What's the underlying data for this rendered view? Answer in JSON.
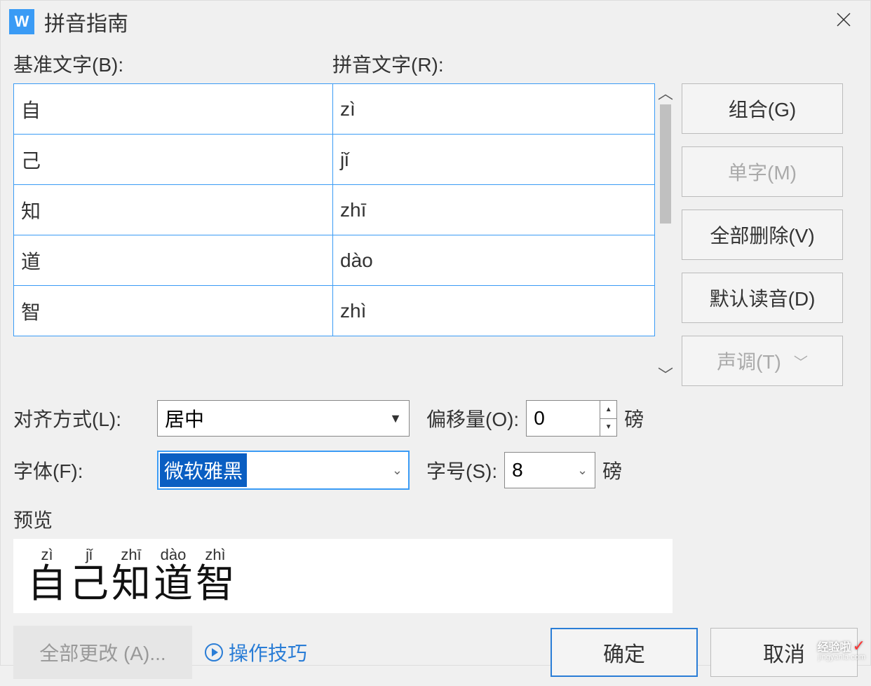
{
  "window": {
    "title": "拼音指南",
    "app_icon_letter": "W"
  },
  "labels": {
    "base_text": "基准文字(B):",
    "pinyin_text": "拼音文字(R):",
    "align": "对齐方式(L):",
    "offset": "偏移量(O):",
    "font": "字体(F):",
    "size": "字号(S):",
    "unit_pt": "磅",
    "preview": "预览"
  },
  "table": {
    "rows": [
      {
        "base": "自",
        "pinyin": "zì"
      },
      {
        "base": "己",
        "pinyin": "jǐ"
      },
      {
        "base": "知",
        "pinyin": "zhī"
      },
      {
        "base": "道",
        "pinyin": "dào"
      },
      {
        "base": "智",
        "pinyin": "zhì"
      }
    ]
  },
  "side_buttons": {
    "combine": "组合(G)",
    "single": "单字(M)",
    "delete_all": "全部删除(V)",
    "default_reading": "默认读音(D)",
    "tone": "声调(T)"
  },
  "form": {
    "align_value": "居中",
    "offset_value": "0",
    "font_value": "微软雅黑",
    "size_value": "8"
  },
  "preview": {
    "items": [
      {
        "ruby": "zì",
        "base": "自"
      },
      {
        "ruby": "jǐ",
        "base": "己"
      },
      {
        "ruby": "zhī",
        "base": "知"
      },
      {
        "ruby": "dào",
        "base": "道"
      },
      {
        "ruby": "zhì",
        "base": "智"
      }
    ]
  },
  "bottom": {
    "change_all": "全部更改 (A)...",
    "tips": "操作技巧",
    "ok": "确定",
    "cancel": "取消"
  },
  "watermark": {
    "line1": "经验啦",
    "line2": "jingyanla.com"
  }
}
